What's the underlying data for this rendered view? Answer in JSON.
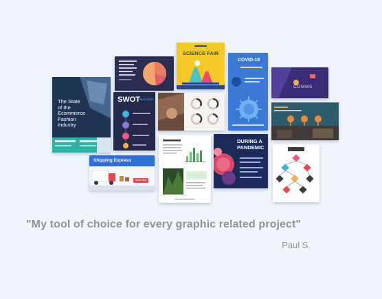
{
  "testimonial": {
    "quote": "\"My tool of choice for every graphic related project\"",
    "author": "Paul S."
  },
  "templates": {
    "ecommerce_title": [
      "The State",
      "of the",
      "Ecommerce",
      "Fashion",
      "Industry"
    ],
    "swot_title": "SWOT",
    "swot_sub": "ANALYSIS",
    "science_title": "SCIENCE FAIR",
    "covid_title": "COVID-19",
    "comms_title": "COMMS",
    "pandemic_title": [
      "DURING A",
      "PANDEMIC"
    ],
    "shipping_title": "Shipping Express",
    "shipping_button": "Order Now"
  },
  "colors": {
    "background": "#f1f6fd",
    "quote_text": "#8e949a"
  }
}
